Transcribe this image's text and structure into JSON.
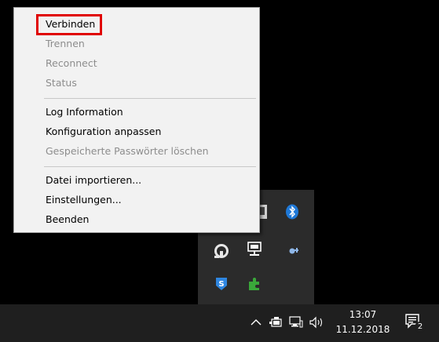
{
  "context_menu": {
    "items": [
      {
        "label": "Verbinden",
        "enabled": true,
        "highlighted": true
      },
      {
        "label": "Trennen",
        "enabled": false
      },
      {
        "label": "Reconnect",
        "enabled": false
      },
      {
        "label": "Status",
        "enabled": false
      },
      {
        "label": "Log Information",
        "enabled": true
      },
      {
        "label": "Konfiguration anpassen",
        "enabled": true
      },
      {
        "label": "Gespeicherte Passwörter löschen",
        "enabled": false
      },
      {
        "label": "Datei importieren...",
        "enabled": true
      },
      {
        "label": "Einstellungen...",
        "enabled": true
      },
      {
        "label": "Beenden",
        "enabled": true
      }
    ],
    "highlight_color": "#e00000"
  },
  "tray_overflow": {
    "icons": [
      "network-monitor-icon",
      "bluetooth-icon",
      "openvpn-icon",
      "network-monitor-icon",
      "magnifier-icon",
      "shield-s-icon",
      "puzzle-icon"
    ]
  },
  "taskbar": {
    "icons": [
      "chevron-up-icon",
      "battery-icon",
      "network-icon",
      "volume-icon"
    ],
    "clock": {
      "time": "13:07",
      "date": "11.12.2018"
    },
    "notifications": {
      "count": "2"
    },
    "colors": {
      "background": "#1f1f1f",
      "text": "#ffffff"
    }
  }
}
